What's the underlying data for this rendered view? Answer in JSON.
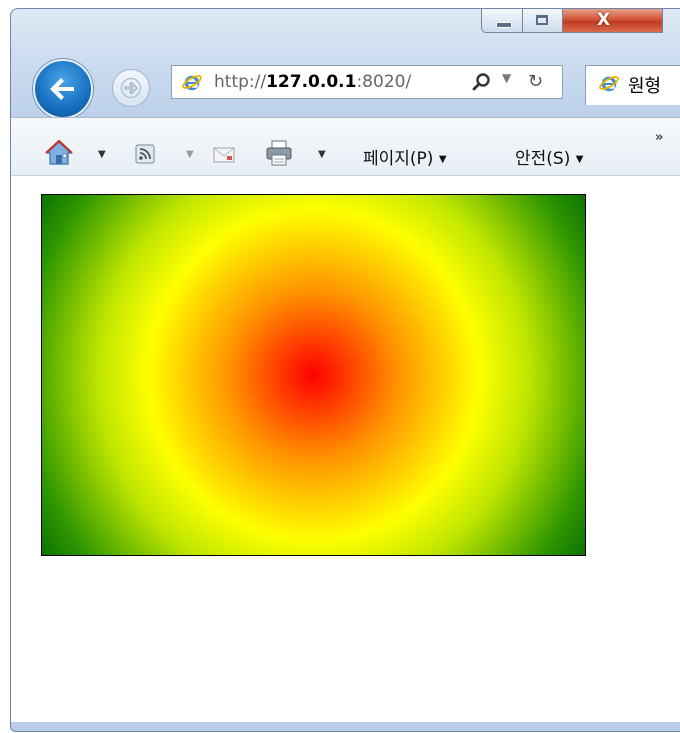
{
  "window": {
    "caption_buttons": {
      "minimize_icon": "minimize-icon",
      "maximize_icon": "maximize-icon",
      "close_label": "X"
    }
  },
  "nav": {
    "back_icon": "back-arrow-icon",
    "forward_icon": "forward-arrow-icon",
    "address": {
      "prefix": "http://",
      "host": "127.0.0.1",
      "suffix": ":8020/"
    },
    "tab_title": "원형"
  },
  "command_bar": {
    "icons": [
      "home-icon",
      "feeds-icon",
      "read-mail-icon",
      "print-icon"
    ],
    "page_menu": "페이지(P)",
    "safety_menu": "안전(S)",
    "more": "»"
  },
  "content": {
    "canvas": {
      "gradient": "radial",
      "colors": [
        "#ff0000",
        "#ff9400",
        "#ffff00",
        "#bfe600",
        "#006400"
      ]
    }
  }
}
